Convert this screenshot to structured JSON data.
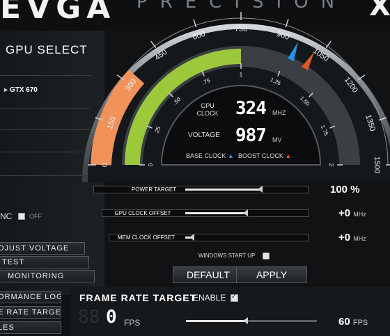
{
  "brand": {
    "left_logo": "EVGA",
    "center_logo": "PRECISION",
    "right_logo": "X"
  },
  "left": {
    "gpu_select": "GPU SELECT",
    "gpu_item": "GTX 670",
    "sync_label": "NC",
    "off_label": "OFF",
    "buttons": [
      "OJUST VOLTAGE",
      "TEST",
      "MONITORING",
      "ORMANCE LOG",
      "E RATE TARGET",
      "LES"
    ]
  },
  "gauge": {
    "outer_ticks": [
      "0",
      "150",
      "300",
      "450",
      "600",
      "750",
      "900",
      "1050",
      "1200",
      "1350",
      "1500"
    ],
    "inner_ticks": [
      "0",
      ".25",
      ".50",
      ".75",
      "1",
      "1.25",
      "1.50",
      "1.75",
      "2"
    ],
    "gpu_clock_label": "GPU CLOCK",
    "gpu_clock_value": "324",
    "gpu_clock_unit": "MHZ",
    "voltage_label": "VOLTAGE",
    "voltage_value": "987",
    "voltage_unit": "MV",
    "base_clock_label": "BASE CLOCK",
    "boost_clock_label": "BOOST CLOCK",
    "colors": {
      "clock_arc": "#f0925a",
      "voltage_arc": "#9cc83c",
      "base_marker": "#2a8fe8",
      "boost_marker": "#e0562a"
    }
  },
  "sliders": [
    {
      "label": "POWER TARGET",
      "value": "100 %",
      "unit": "",
      "level": 0.62
    },
    {
      "label": "GPU CLOCK OFFSET",
      "value": "+0",
      "unit": "MHz",
      "level": 0.5
    },
    {
      "label": "MEM CLOCK OFFSET",
      "value": "+0",
      "unit": "MHz",
      "level": 0.05
    }
  ],
  "windows_startup": "WINDOWS START UP",
  "default_button": "DEFAULT",
  "apply_button": "APPLY",
  "frame_rate": {
    "title": "FRAME RATE TARGET",
    "enable_label": "ENABLE",
    "fps_value": "0",
    "fps_label": "FPS",
    "target_value": "60",
    "target_unit": "FPS",
    "level": 0.45
  }
}
